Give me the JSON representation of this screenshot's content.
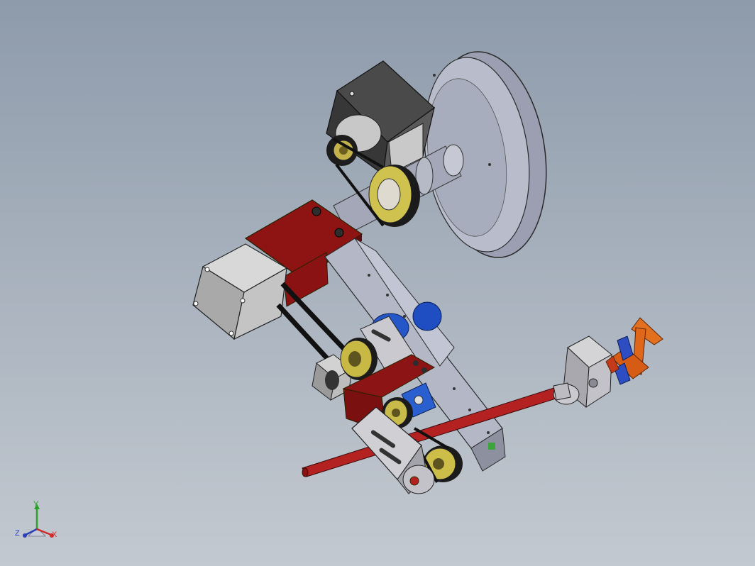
{
  "viewport": {
    "background_top": "#8e9bab",
    "background_bottom": "#c3c9d0"
  },
  "triad": {
    "x_label": "X",
    "y_label": "Y",
    "z_label": "Z",
    "x_color": "#d02a2a",
    "y_color": "#2ea02e",
    "z_color": "#2a3fb8"
  },
  "model": {
    "parts": [
      "large-disc-wheel",
      "upper-motor-bracket",
      "main-shaft",
      "drive-pulley",
      "red-mount-plate",
      "nema-stepper-motor-large",
      "drive-belts",
      "aluminum-frame-rail",
      "blue-pillow-bearings",
      "small-stepper-motor",
      "red-lower-plate",
      "slotted-bracket",
      "lower-pulleys",
      "red-rod",
      "end-motor-assembly",
      "orange-gripper"
    ]
  }
}
